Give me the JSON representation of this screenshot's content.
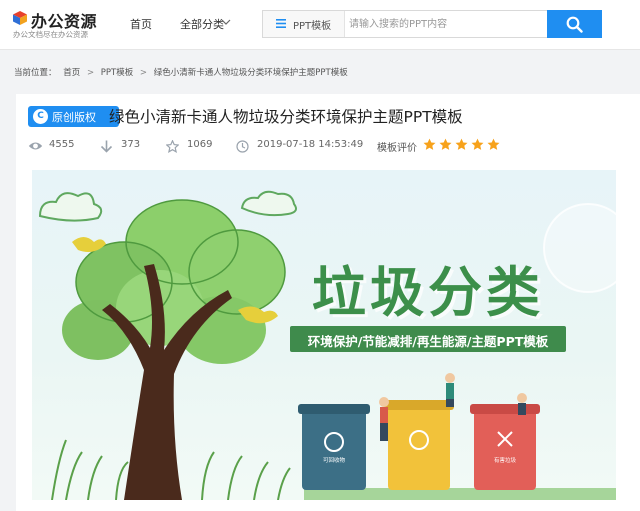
{
  "logo": {
    "title": "办公资源",
    "subtitle": "办公文档尽在办公资源",
    "icon": "cube-logo-icon"
  },
  "nav": {
    "home": "首页",
    "all_categories": "全部分类"
  },
  "search": {
    "category": "PPT模板",
    "placeholder": "请输入搜索的PPT内容",
    "value": ""
  },
  "breadcrumb": {
    "label": "当前位置：",
    "items": [
      "首页",
      "PPT模板",
      "绿色小清新卡通人物垃圾分类环境保护主题PPT模板"
    ],
    "separator": ">"
  },
  "resource": {
    "badge": "原创版权",
    "badge_icon_text": "C",
    "title": "绿色小清新卡通人物垃圾分类环境保护主题PPT模板",
    "views": "4555",
    "downloads": "373",
    "favorites": "1069",
    "datetime": "2019-07-18 14:53:49",
    "rating_label": "模板评价",
    "rating": 5,
    "rating_max": 5
  },
  "preview": {
    "cover_title": "垃圾分类",
    "cover_subtitle": "环境保护/节能减排/再生能源/主题PPT模板",
    "bin_labels": [
      "可回收物",
      "有害垃圾"
    ]
  },
  "colors": {
    "accent": "#1f8ef1",
    "star": "#f7a21b",
    "cover_green": "#3c8f4a"
  }
}
